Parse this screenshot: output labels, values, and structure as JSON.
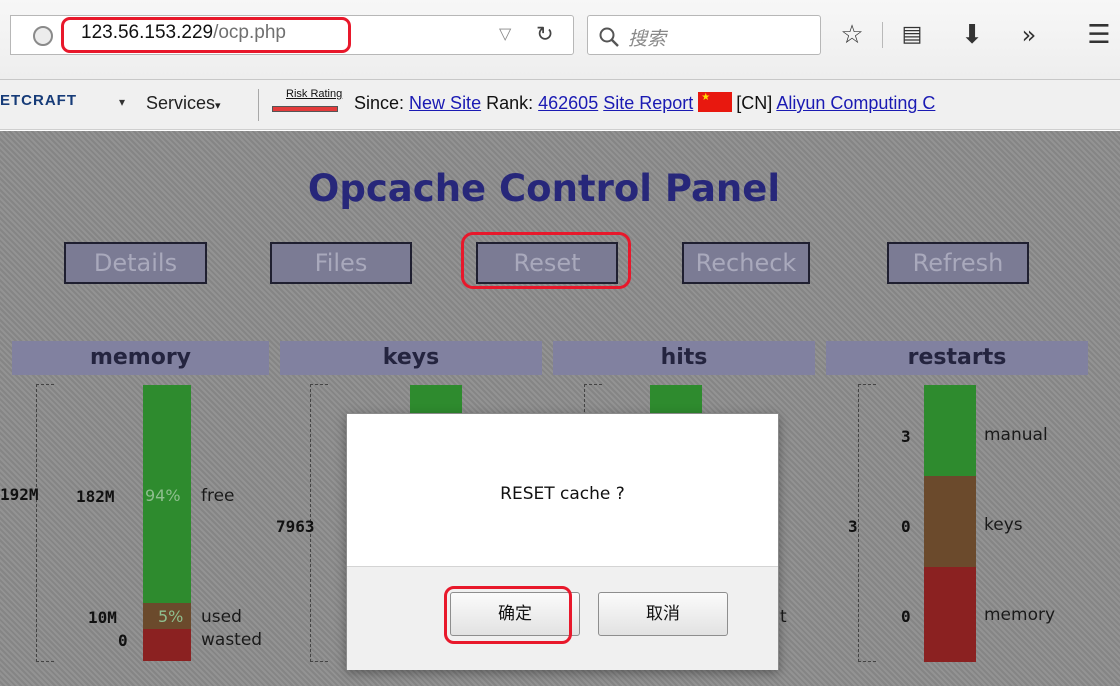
{
  "browser": {
    "url_host": "123.56.153.229",
    "url_path": "/ocp.php",
    "search_placeholder": "搜索",
    "toolbar_icons": [
      "bookmark-star-icon",
      "reading-list-icon",
      "download-icon",
      "overflow-chevron-icon",
      "menu-icon"
    ]
  },
  "bookmarks_bar": {
    "netcraft_logo": "ETCRAFT",
    "services": "Services",
    "risk_rating": "Risk Rating",
    "since_label": "Since:",
    "since_value": "New Site",
    "rank_label": "Rank:",
    "rank_value": "462605",
    "site_report": "Site Report",
    "country_code": "[CN]",
    "hosting": "Aliyun Computing C"
  },
  "page": {
    "title": "Opcache Control Panel",
    "nav_buttons": [
      "Details",
      "Files",
      "Reset",
      "Recheck",
      "Refresh"
    ],
    "panels": {
      "memory": {
        "heading": "memory",
        "total": "192M",
        "free_value": "182M",
        "free_pct": "94%",
        "free_label": "free",
        "used_value": "10M",
        "used_pct": "5%",
        "used_label": "used",
        "wasted_value": "0",
        "wasted_label": "wasted"
      },
      "keys": {
        "heading": "keys",
        "total": "7963"
      },
      "hits": {
        "heading": "hits",
        "partial_label": "t"
      },
      "restarts": {
        "heading": "restarts",
        "total": "3",
        "manual_value": "3",
        "manual_label": "manual",
        "keys_value": "0",
        "keys_label": "keys",
        "memory_value": "0",
        "memory_label": "memory"
      }
    }
  },
  "colors": {
    "free": "#2e8b2e",
    "used": "#6b4a2c",
    "wasted": "#8b2121",
    "annotation": "#e8182b"
  },
  "dialog": {
    "message": "RESET cache ?",
    "ok_label": "确定",
    "cancel_label": "取消"
  }
}
